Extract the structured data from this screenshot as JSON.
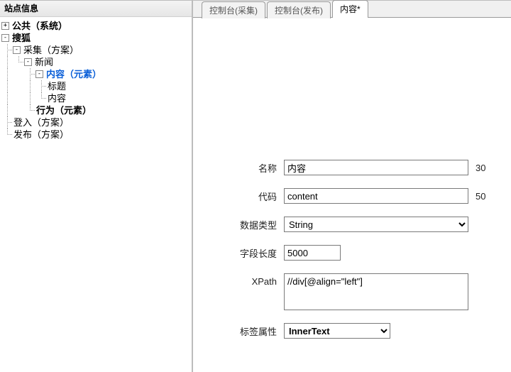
{
  "left": {
    "title": "站点信息",
    "toggle_plus": "+",
    "toggle_minus": "-",
    "tree": {
      "n0": "公共（系统）",
      "n1": "搜狐",
      "n2": "采集（方案）",
      "n3": "新闻",
      "n4": "内容（元素）",
      "n5": "标题",
      "n6": "内容",
      "n7": "行为（元素）",
      "n8": "登入（方案）",
      "n9": "发布（方案）"
    }
  },
  "tabs": {
    "t0": "控制台(采集)",
    "t1": "控制台(发布)",
    "t2": "内容*"
  },
  "form": {
    "name_label": "名称",
    "name_value": "内容",
    "name_max": "30",
    "code_label": "代码",
    "code_value": "content",
    "code_max": "50",
    "dtype_label": "数据类型",
    "dtype_value": "String",
    "flen_label": "字段长度",
    "flen_value": "5000",
    "xpath_label": "XPath",
    "xpath_value": "//div[@align=\"left\"]",
    "tag_label": "标签属性",
    "tag_value": "InnerText"
  }
}
